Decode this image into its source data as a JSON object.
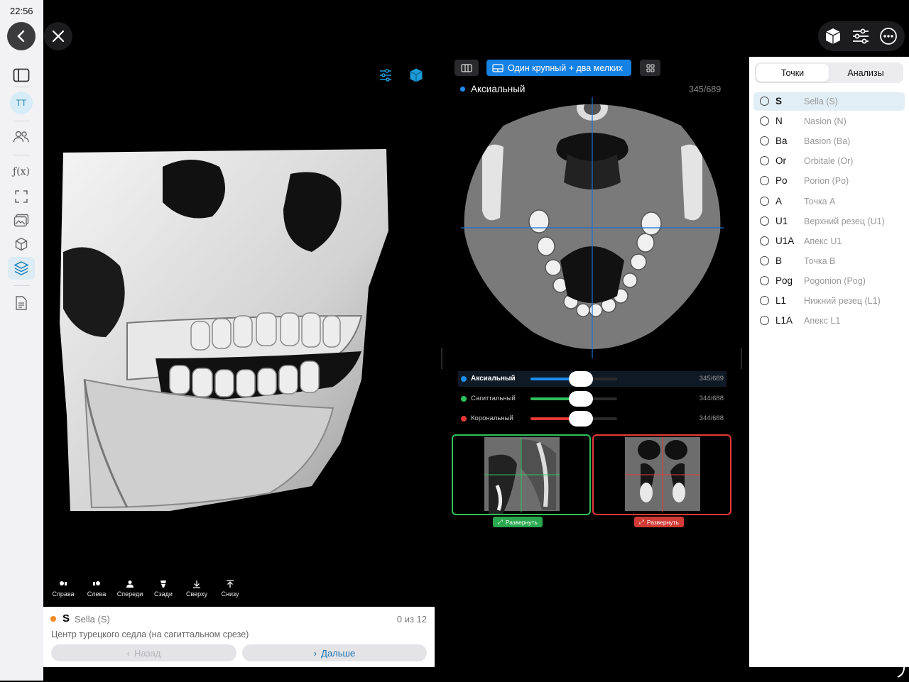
{
  "status": {
    "time": "22:56"
  },
  "sidebar": {
    "avatar_initials": "TT",
    "icons": [
      "sidebar-toggle-icon",
      "avatar",
      "users-icon",
      "function-icon",
      "fullscreen-icon",
      "gallery-icon",
      "cube-icon",
      "layers-icon",
      "document-icon"
    ],
    "function_glyph": "ƒ(x)"
  },
  "viewer3d": {
    "view_buttons": [
      {
        "label": "Справа"
      },
      {
        "label": "Слева"
      },
      {
        "label": "Спереди"
      },
      {
        "label": "Сзади"
      },
      {
        "label": "Сверху"
      },
      {
        "label": "Снизу"
      }
    ]
  },
  "current_point": {
    "code": "S",
    "name": "Sella (S)",
    "progress": "0 из 12",
    "description": "Центр турецкого седла (на сагиттальном срезе)",
    "back_label": "Назад",
    "next_label": "Дальше",
    "dot_color": "#f08a24"
  },
  "slices": {
    "layout_label": "Один крупный + два мелких",
    "main_view": {
      "label": "Аксиальный",
      "count": "345/689"
    },
    "sliders": [
      {
        "label": "Аксиальный",
        "count": "345/689",
        "color": "#1e8ef0",
        "fraction": 0.5
      },
      {
        "label": "Сагиттальный",
        "count": "344/688",
        "color": "#2fc25b",
        "fraction": 0.5
      },
      {
        "label": "Корональный",
        "count": "344/688",
        "color": "#e53935",
        "fraction": 0.5
      }
    ],
    "expand_label_sagittal": "Развернуть",
    "expand_label_coronal": "Развернуть"
  },
  "points_panel": {
    "tabs": [
      {
        "label": "Точки",
        "active": true
      },
      {
        "label": "Анализы",
        "active": false
      }
    ],
    "points": [
      {
        "code": "S",
        "name": "Sella (S)",
        "selected": true
      },
      {
        "code": "N",
        "name": "Nasion (N)"
      },
      {
        "code": "Ba",
        "name": "Basion (Ba)"
      },
      {
        "code": "Or",
        "name": "Orbitale (Or)"
      },
      {
        "code": "Po",
        "name": "Porion (Po)"
      },
      {
        "code": "A",
        "name": "Точка A"
      },
      {
        "code": "U1",
        "name": "Верхний резец (U1)"
      },
      {
        "code": "U1A",
        "name": "Апекс U1"
      },
      {
        "code": "B",
        "name": "Точка B"
      },
      {
        "code": "Pog",
        "name": "Pogonion (Pog)"
      },
      {
        "code": "L1",
        "name": "Нижний резец (L1)"
      },
      {
        "code": "L1A",
        "name": "Апекс L1"
      }
    ]
  },
  "colors": {
    "accent": "#1681e4",
    "teal": "#1b9bd8",
    "sagittal": "#2fc25b",
    "coronal": "#e53935"
  }
}
